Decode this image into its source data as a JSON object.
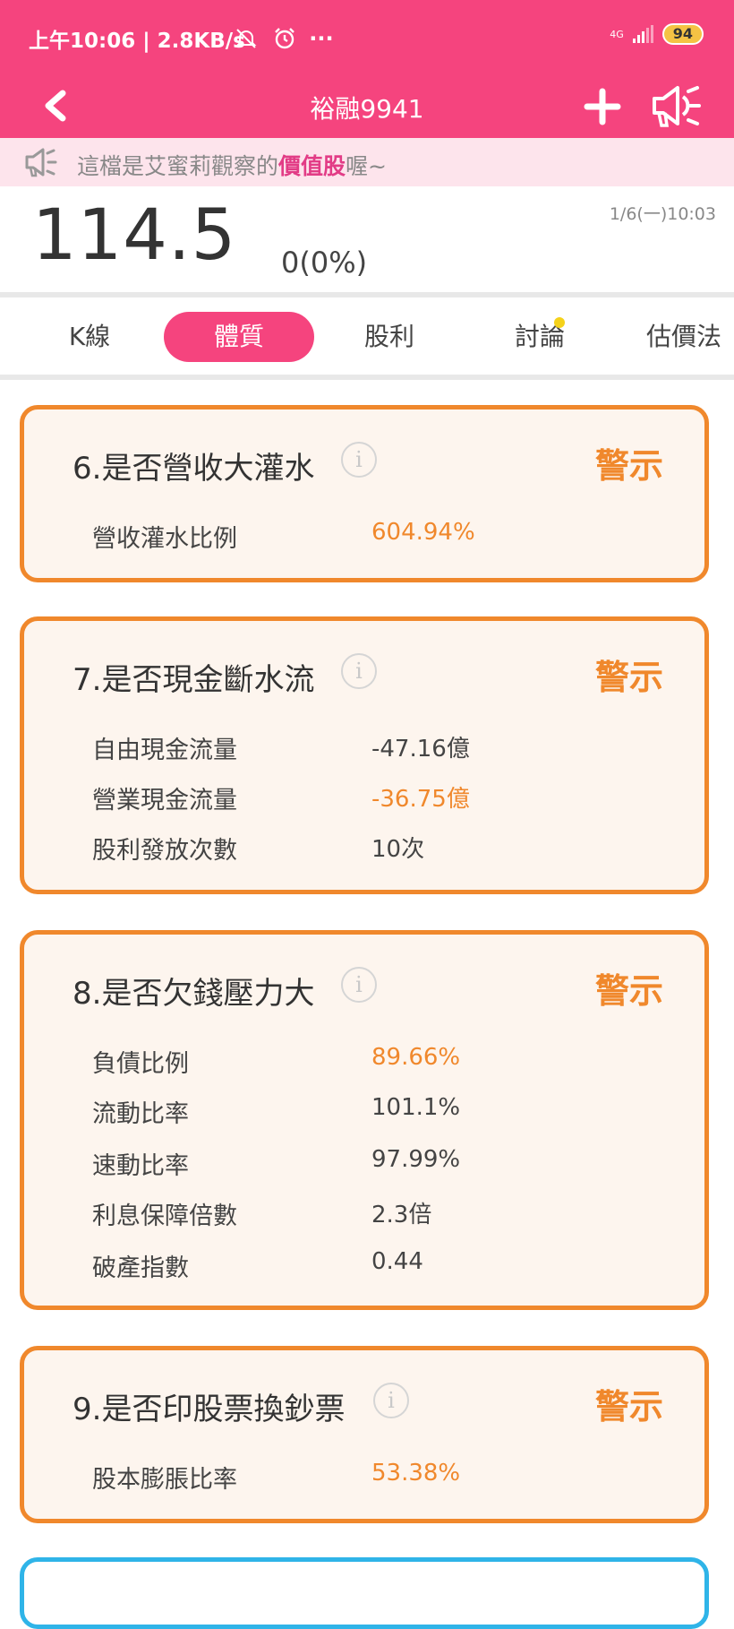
{
  "status_bar": {
    "time": "上午10:06",
    "speed": "2.8KB/s",
    "more": "···",
    "network": "4G",
    "battery": "94",
    "icons": [
      "mute-icon",
      "alarm-icon",
      "signal-icon",
      "battery-icon"
    ]
  },
  "header": {
    "title": "裕融9941",
    "icons": [
      "back-icon",
      "plus-icon",
      "speaker-icon"
    ]
  },
  "announcement": {
    "prefix": "這檔是艾蜜莉觀察的",
    "highlight": "價值股",
    "suffix": "喔~"
  },
  "quote": {
    "price": "114.5",
    "change": "0(0%)",
    "timestamp": "1/6(一)10:03"
  },
  "tabs": [
    {
      "label": "K線"
    },
    {
      "label": "體質"
    },
    {
      "label": "股利"
    },
    {
      "label": "討論"
    },
    {
      "label": "估價法"
    }
  ],
  "active_tab": "體質",
  "cards": [
    {
      "title": "6.是否營收大灌水",
      "status": "警示",
      "rows": [
        {
          "label": "營收灌水比例",
          "value": "604.94%"
        }
      ]
    },
    {
      "title": "7.是否現金斷水流",
      "status": "警示",
      "rows": [
        {
          "label": "自由現金流量",
          "value": "-47.16億"
        },
        {
          "label": "營業現金流量",
          "value": "-36.75億"
        },
        {
          "label": "股利發放次數",
          "value": "10次"
        }
      ]
    },
    {
      "title": "8.是否欠錢壓力大",
      "status": "警示",
      "rows": [
        {
          "label": "負債比例",
          "value": "89.66%"
        },
        {
          "label": "流動比率",
          "value": "101.1%"
        },
        {
          "label": "速動比率",
          "value": "97.99%"
        },
        {
          "label": "利息保障倍數",
          "value": "2.3倍"
        },
        {
          "label": "破產指數",
          "value": "0.44"
        }
      ]
    },
    {
      "title": "9.是否印股票換鈔票",
      "status": "警示",
      "rows": [
        {
          "label": "股本膨脹比率",
          "value": "53.38%"
        }
      ]
    }
  ],
  "info_glyph": "i",
  "colors": {
    "brand_pink": "#f5447e",
    "warning_orange": "#f0882c",
    "card_bg": "#fdf5ee",
    "next_card_blue": "#2fb4e8",
    "notification_dot": "#f5d21a"
  }
}
